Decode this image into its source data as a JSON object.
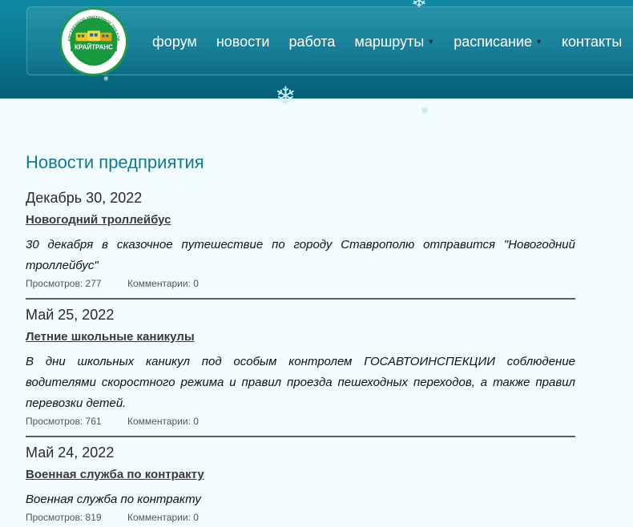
{
  "header": {
    "logo": {
      "arc_text": "ГОСУДАРСТВЕННОЕ УНИТАРНОЕ ПРЕДПРИЯТИЕ",
      "name": "КРАЙТРАНС",
      "bottom_text": "СТАВРОПОЛЬСКОГО КРАЯ"
    },
    "nav": [
      {
        "label": "форум",
        "dropdown": false
      },
      {
        "label": "новости",
        "dropdown": false
      },
      {
        "label": "работа",
        "dropdown": false
      },
      {
        "label": "маршруты",
        "dropdown": true
      },
      {
        "label": "расписание",
        "dropdown": true
      },
      {
        "label": "контакты",
        "dropdown": false
      }
    ]
  },
  "main": {
    "title": "Новости предприятия",
    "items": [
      {
        "date": "Декабрь 30, 2022",
        "title": "Новогодний троллейбус",
        "text": "30 декабря в сказочное путешествие по городу Ставрополю отправится \"Новогодний троллейбус\"",
        "views": "Просмотров: 277",
        "comments": "Комментарии: 0"
      },
      {
        "date": "Май 25, 2022",
        "title": "Летние школьные каникулы",
        "text": "В дни школьных каникул под особым контролем ГОСАВТОИНСПЕКЦИИ соблюдение водителями скоростного режима и правил проезда пешеходных переходов, а также правил перевозки детей.",
        "views": "Просмотров: 761",
        "comments": "Комментарии: 0"
      },
      {
        "date": "Май 24, 2022",
        "title": "Военная служба по контракту",
        "text": "Военная служба по контракту",
        "views": "Просмотров: 819",
        "comments": "Комментарии: 0"
      }
    ]
  },
  "decor": {
    "snowflake_icon": "snowflake-icon",
    "chevron_icon": "chevron-down-icon",
    "accent": "#0e7a92",
    "header_color": "#0b7690"
  }
}
